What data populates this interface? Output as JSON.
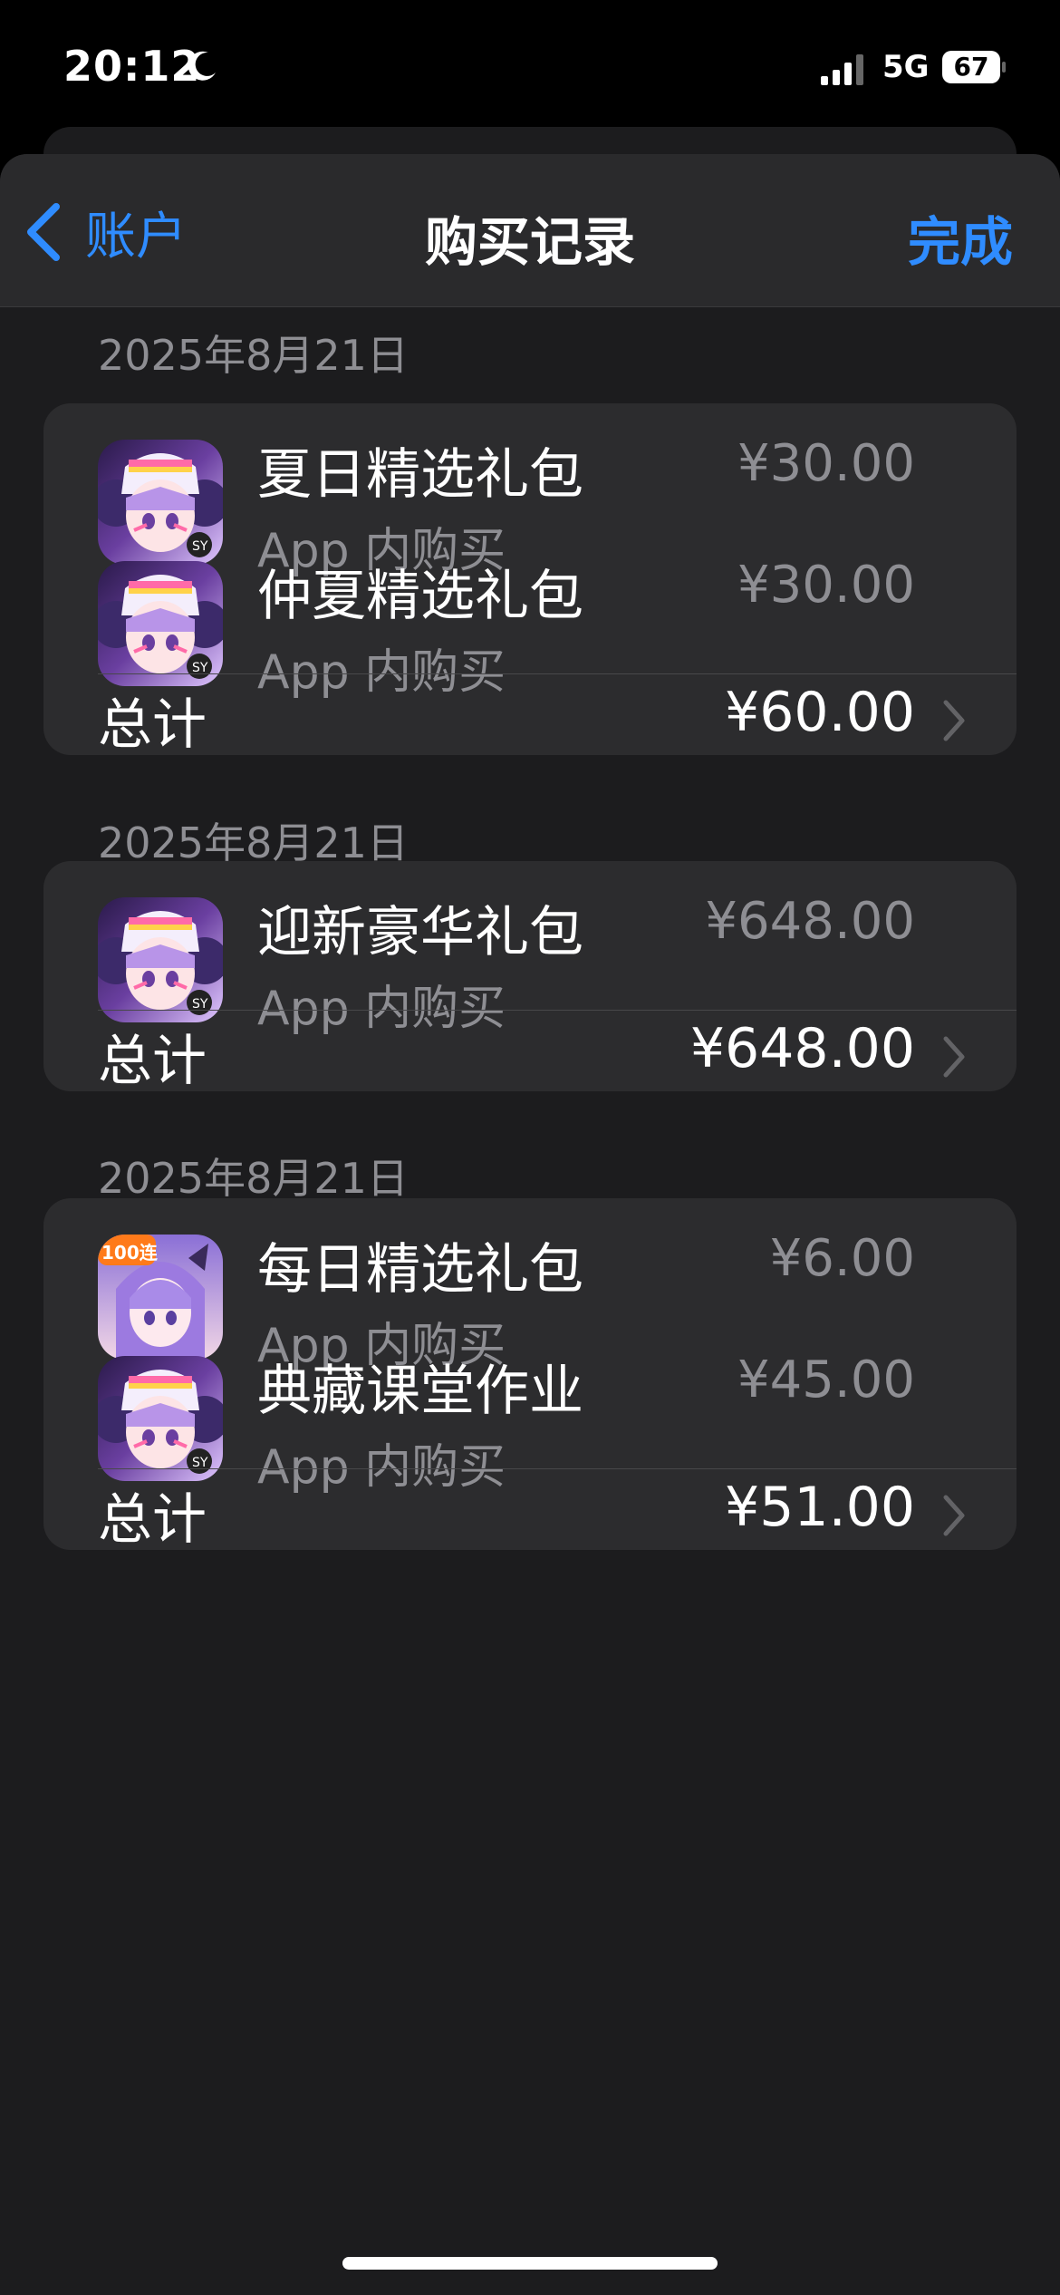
{
  "status_bar": {
    "time": "20:12",
    "network": "5G",
    "battery": "67"
  },
  "nav": {
    "back_label": "账户",
    "title": "购买记录",
    "done_label": "完成"
  },
  "colors": {
    "accent": "#2f8cff",
    "background": "#1c1c1e",
    "card": "#2c2c2e",
    "secondary_text": "#8e8e93"
  },
  "groups": [
    {
      "date": "2025年8月21日",
      "items": [
        {
          "name": "夏日精选礼包",
          "type": "App 内购买",
          "price": "¥30.00",
          "icon": "game-app-icon"
        },
        {
          "name": "仲夏精选礼包",
          "type": "App 内购买",
          "price": "¥30.00",
          "icon": "game-app-icon"
        }
      ],
      "total_label": "总计",
      "total": "¥60.00"
    },
    {
      "date": "2025年8月21日",
      "items": [
        {
          "name": "迎新豪华礼包",
          "type": "App 内购买",
          "price": "¥648.00",
          "icon": "game-app-icon"
        }
      ],
      "total_label": "总计",
      "total": "¥648.00"
    },
    {
      "date": "2025年8月21日",
      "items": [
        {
          "name": "每日精选礼包",
          "type": "App 内购买",
          "price": "¥6.00",
          "icon": "game-app-icon-100-draws",
          "badge": "100连"
        },
        {
          "name": "典藏课堂作业",
          "type": "App 内购买",
          "price": "¥45.00",
          "icon": "game-app-icon"
        }
      ],
      "total_label": "总计",
      "total": "¥51.00"
    }
  ]
}
